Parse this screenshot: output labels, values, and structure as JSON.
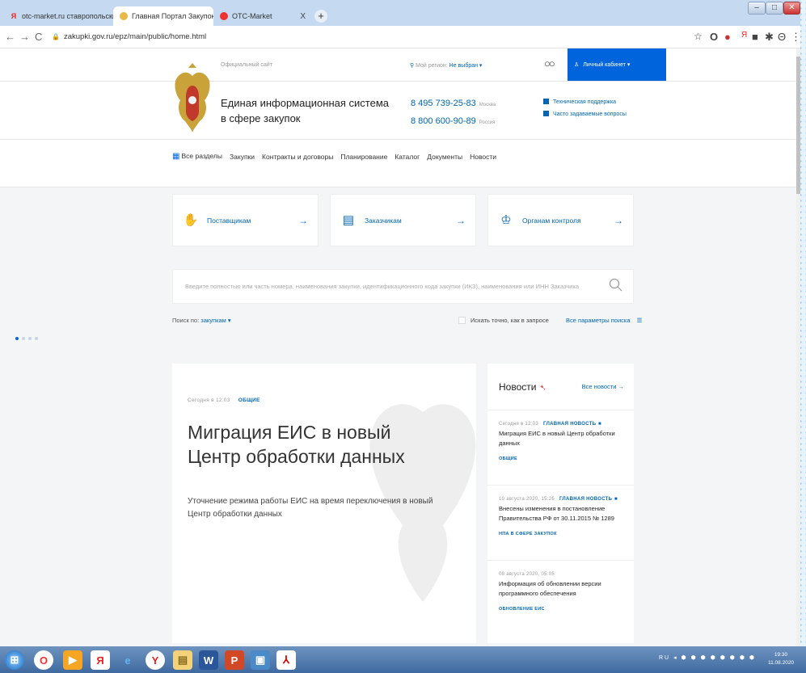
{
  "browser": {
    "tabs": [
      {
        "label": "otc-market.ru ставропольский",
        "active": false,
        "close": "X"
      },
      {
        "label": "Главная Портал Закупок",
        "active": true,
        "close": "X"
      },
      {
        "label": "OTC-Market",
        "active": false,
        "close": "X"
      }
    ],
    "new_tab": "+",
    "url": "zakupki.gov.ru/epz/main/public/home.html"
  },
  "header": {
    "official_site": "Официальный сайт",
    "region_label": "Мой регион:",
    "region_value": "Не выбран ▾",
    "cabinet_label": "Личный кабинет ▾",
    "title_line1": "Единая информационная система",
    "title_line2": "в сфере закупок",
    "phones": [
      {
        "number": "8 495 739-25-83",
        "note": "Москва"
      },
      {
        "number": "8 800 600-90-89",
        "note": "Россия"
      }
    ],
    "support_links": [
      "Техническая поддержка",
      "Часто задаваемые вопросы"
    ]
  },
  "nav": {
    "all_sections": "Все разделы",
    "items": [
      "Закупки",
      "Контракты и договоры",
      "Планирование",
      "Каталог",
      "Документы",
      "Новости"
    ]
  },
  "audience_cards": [
    {
      "label": "Поставщикам",
      "icon": "handshake-icon"
    },
    {
      "label": "Заказчикам",
      "icon": "document-icon"
    },
    {
      "label": "Органам контроля",
      "icon": "emblem-icon"
    }
  ],
  "search": {
    "placeholder": "Введите полностью или часть номера, наименования закупки, идентификационного кода закупки (ИКЗ), наименования или ИНН Заказчика",
    "search_by_label": "Поиск по:",
    "search_by_value": "закупкам ▾",
    "exact_label": "Искать точно, как в запросе",
    "all_params": "Все параметры поиска"
  },
  "hero": {
    "date": "Сегодня в 12:03",
    "category": "ОБЩИЕ",
    "title": "Миграция ЕИС в новый Центр обработки данных",
    "subtitle": "Уточнение режима работы ЕИС на время переключения в новый Центр обработки данных",
    "slides": 4,
    "active_slide": 1
  },
  "news": {
    "heading": "Новости",
    "all_news": "Все новости",
    "items": [
      {
        "date": "Сегодня в 12:03",
        "tag": "ГЛАВНАЯ НОВОСТЬ",
        "text": "Миграция ЕИС в новый Центр обработки данных",
        "category": "ОБЩИЕ"
      },
      {
        "date": "10 августа 2020, 15:26",
        "tag": "ГЛАВНАЯ НОВОСТЬ",
        "text": "Внесены изменения в постановление Правительства РФ от 30.11.2015 № 1289",
        "category": "НПА В СФЕРЕ ЗАКУПОК"
      },
      {
        "date": "08 августа 2020, 05:05",
        "tag": "",
        "text": "Информация об обновлении версии программного обеспечения",
        "category": "ОБНОВЛЕНИЕ ЕИС"
      }
    ]
  },
  "taskbar": {
    "lang": "RU",
    "time": "19:30",
    "date": "11.08.2020"
  },
  "colors": {
    "accent": "#0065dd",
    "link": "#0065b1"
  }
}
